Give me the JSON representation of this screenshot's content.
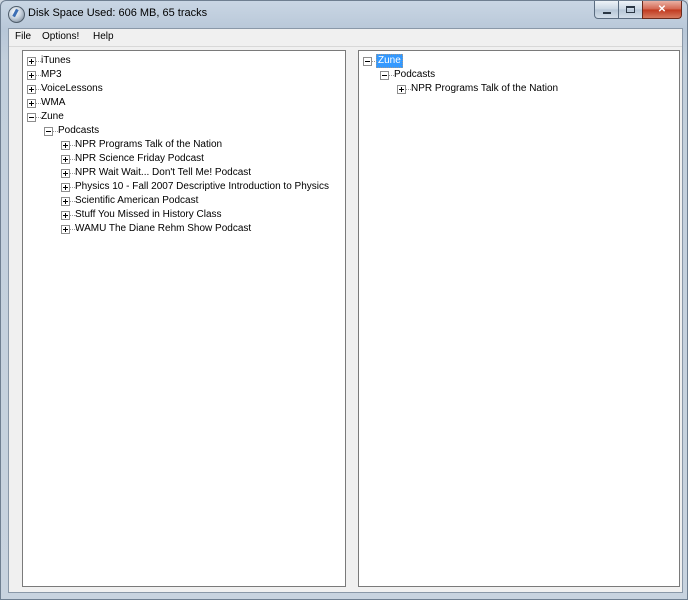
{
  "window": {
    "title": "Disk Space Used: 606 MB, 65 tracks",
    "minimize_label": "",
    "maximize_label": "",
    "close_label": "✕"
  },
  "menu": {
    "file": "File",
    "options": "Options!",
    "help": "Help"
  },
  "left_tree": {
    "itunes": "iTunes",
    "mp3": "MP3",
    "voicelessons": "VoiceLessons",
    "wma": "WMA",
    "zune": "Zune",
    "podcasts": "Podcasts",
    "items": [
      "NPR Programs Talk of the Nation",
      "NPR Science Friday Podcast",
      "NPR Wait Wait... Don't Tell Me! Podcast",
      "Physics 10 - Fall 2007 Descriptive Introduction to Physics",
      "Scientific American Podcast",
      "Stuff You Missed in History Class",
      "WAMU The Diane Rehm Show Podcast"
    ]
  },
  "right_tree": {
    "zune": "Zune",
    "podcasts": "Podcasts",
    "item": "NPR Programs Talk of the Nation"
  }
}
